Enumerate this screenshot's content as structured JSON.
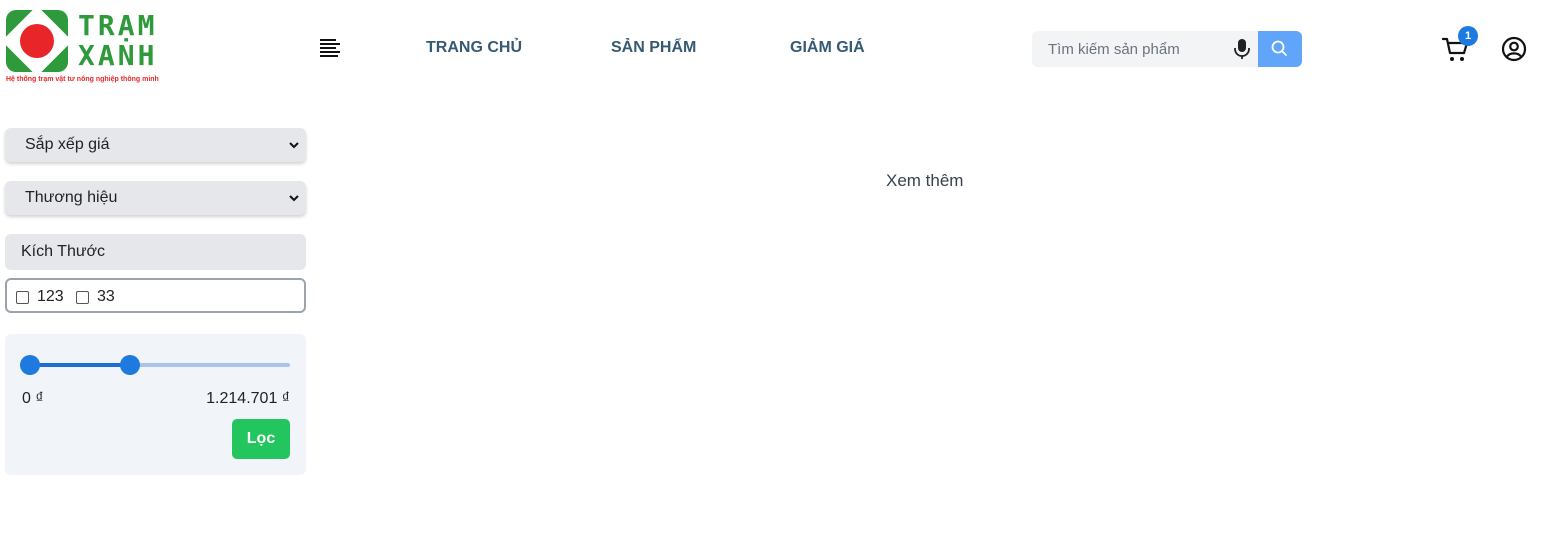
{
  "brand": {
    "word1": "TRẠM",
    "word2": "XANH",
    "tagline": "Hệ thống trạm vật tư nông nghiệp thông minh",
    "green": "#2e9a3c",
    "red": "#e8262a"
  },
  "nav": {
    "items": [
      {
        "label": "TRANG CHỦ"
      },
      {
        "label": "SẢN PHẨM"
      },
      {
        "label": "GIẢM GIÁ"
      }
    ]
  },
  "search": {
    "placeholder": "Tìm kiếm sản phẩm",
    "value": ""
  },
  "cart": {
    "count": "1"
  },
  "icons": {
    "menu": "menu-lines-icon",
    "mic": "microphone-icon",
    "search": "search-icon",
    "cart": "cart-icon",
    "user": "user-circle-icon"
  },
  "filters": {
    "sort_label": "Sắp xếp giá",
    "brand_label": "Thương hiệu",
    "size_title": "Kích Thước",
    "sizes": [
      {
        "label": "123",
        "checked": false
      },
      {
        "label": "33",
        "checked": false
      }
    ],
    "price": {
      "min_text": "0 ₫",
      "max_text": "1.214.701 ₫",
      "range_low_fraction": 0.0,
      "range_high_fraction": 0.4
    },
    "filter_button": "Lọc"
  },
  "main": {
    "see_more": "Xem thêm"
  },
  "colors": {
    "nav_text": "#365a73",
    "accent_blue": "#1f7ae0",
    "search_button": "#60a5fa",
    "filter_button": "#22c55e"
  }
}
